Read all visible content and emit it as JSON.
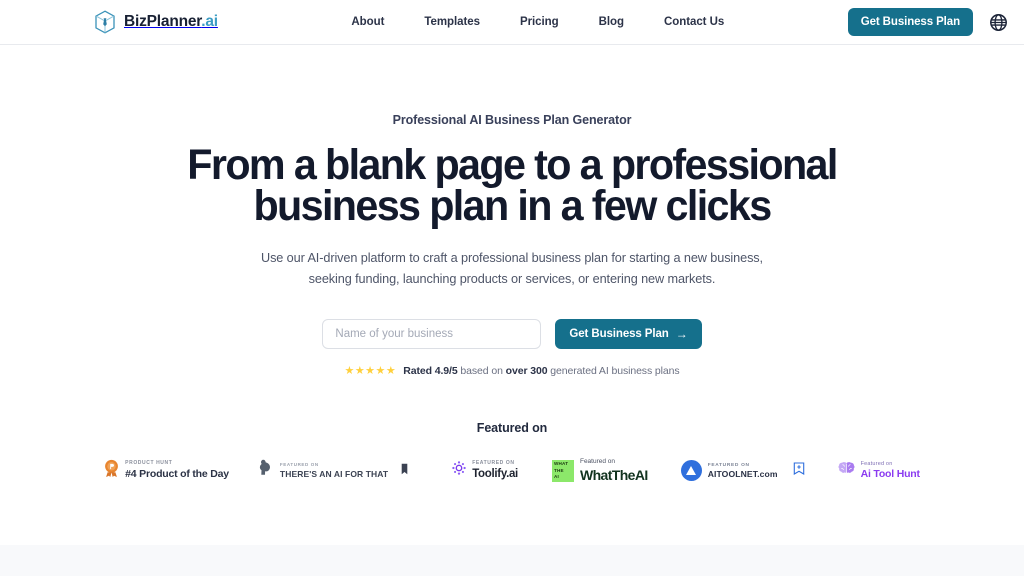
{
  "header": {
    "brand_name": "BizPlanner",
    "brand_suffix": ".ai",
    "logo_icon": "cube-tie-icon",
    "nav": [
      {
        "label": "About"
      },
      {
        "label": "Templates"
      },
      {
        "label": "Pricing"
      },
      {
        "label": "Blog"
      },
      {
        "label": "Contact Us"
      }
    ],
    "cta_label": "Get Business Plan",
    "language_icon": "globe-icon"
  },
  "hero": {
    "eyebrow": "Professional AI Business Plan Generator",
    "headline_line1": "From a blank page to a professional",
    "headline_line2": "business plan in a few clicks",
    "subcopy_line1": "Use our AI-driven platform to craft a professional business plan for starting a new business,",
    "subcopy_line2": "seeking funding, launching products or services, or entering new markets."
  },
  "form": {
    "input_placeholder": "Name of your business",
    "input_value": "",
    "submit_label": "Get Business Plan",
    "submit_arrow": "→"
  },
  "rating": {
    "stars": "★★★★★",
    "star_count": 5,
    "score_text": "Rated 4.9/5",
    "mid_text": " based on ",
    "count_text": "over 300",
    "tail_text": " generated AI business plans"
  },
  "featured": {
    "title": "Featured on",
    "badges": [
      {
        "id": "product-hunt",
        "icon": "product-hunt-medal-icon",
        "kicker": "PRODUCT HUNT",
        "main": "#4 Product of the Day"
      },
      {
        "id": "theres-an-ai-for-that",
        "icon": "flexed-arm-icon",
        "kicker": "FEATURED ON",
        "main": "THERE'S AN AI FOR THAT",
        "trailing_icon": "bookmark-icon"
      },
      {
        "id": "toolify",
        "icon": "toolify-gear-icon",
        "kicker": "FEATURED ON",
        "main": "Toolify.ai"
      },
      {
        "id": "whattheai",
        "icon": "whattheai-square-icon",
        "square_line1": "WHAT",
        "square_line2": "THE",
        "square_line3": "AI",
        "kicker": "Featured on",
        "main": "WhatTheAI"
      },
      {
        "id": "aitoolnet",
        "icon": "aitoolnet-triangle-icon",
        "kicker": "FEATURED ON",
        "main": "AITOOLNET.com",
        "trailing_icon": "bookmark-plus-icon"
      },
      {
        "id": "ai-tool-hunt",
        "icon": "brain-icon",
        "kicker": "Featured on",
        "main": "Ai Tool Hunt"
      }
    ]
  },
  "colors": {
    "accent_teal": "#15708c",
    "brand_blue": "#3d9dc4",
    "heading_navy": "#131a2c",
    "star_gold": "#ffd03c",
    "hunt_purple": "#8b3bf0",
    "whattheai_green": "#8ce86a",
    "aitoolnet_blue": "#2f6fdd",
    "strip_grey": "#f8f9fb"
  }
}
